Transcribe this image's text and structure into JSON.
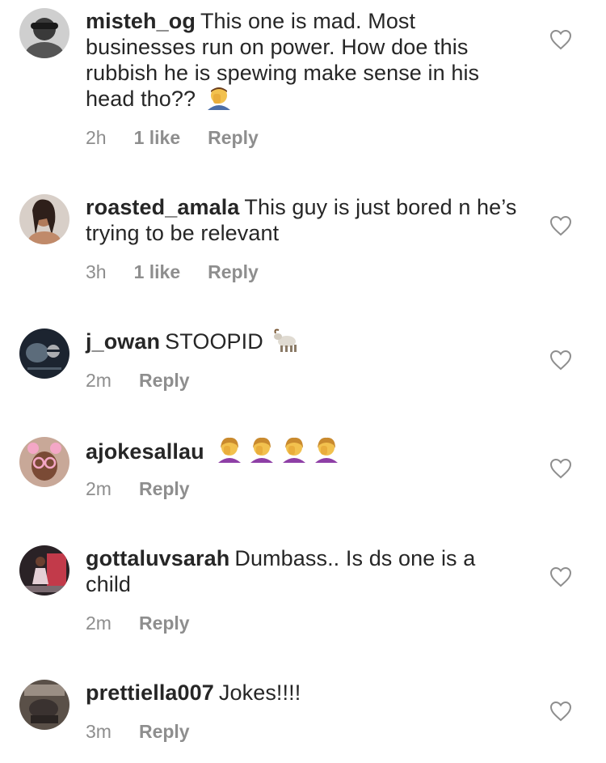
{
  "comments": [
    {
      "username": "misteh_og",
      "text": "This one is mad. Most businesses run on power. How doe this rubbish he is spewing make sense in his head tho??",
      "emoji": "facepalm-man-emoji",
      "time": "2h",
      "likes": "1 like",
      "reply": "Reply"
    },
    {
      "username": "roasted_amala",
      "text": "This guy is just bored n he’s trying to be relevant",
      "time": "3h",
      "likes": "1 like",
      "reply": "Reply"
    },
    {
      "username": "j_owan",
      "text": "STOOPID",
      "emoji": "goat-emoji",
      "time": "2m",
      "reply": "Reply"
    },
    {
      "username": "ajokesallau",
      "text": "",
      "emoji": "facepalm-woman-emoji x4",
      "time": "2m",
      "reply": "Reply"
    },
    {
      "username": "gottaluvsarah",
      "text": "Dumbass.. Is ds one is a child",
      "time": "2m",
      "reply": "Reply"
    },
    {
      "username": "prettiella007",
      "text": "Jokes!!!!",
      "time": "3m",
      "reply": "Reply"
    }
  ],
  "colors": {
    "username": "#262626",
    "text": "#262626",
    "meta": "#8e8e8e",
    "heart_outline": "#8e8e8e"
  }
}
